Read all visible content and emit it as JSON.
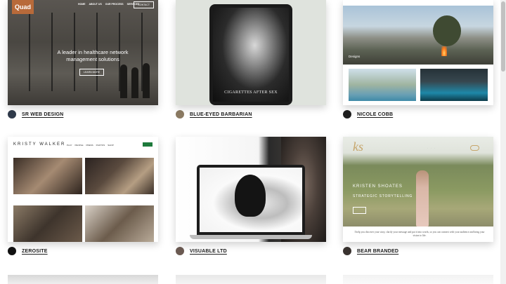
{
  "cards": [
    {
      "caption": "SR WEB DESIGN",
      "avatar_color": "#2f3a4a",
      "preview": {
        "logo": "Quad",
        "nav_links": [
          "HOME",
          "ABOUT US",
          "OUR PROCESS",
          "SERVICES"
        ],
        "contact_label": "CONTACT",
        "headline": "A leader in healthcare network management solutions",
        "button_label": "LEARN MORE"
      }
    },
    {
      "caption": "BLUE-EYED BARBARIAN",
      "avatar_color": "#8b7a62",
      "preview": {
        "screen_text": "CIGARETTES AFTER SEX"
      }
    },
    {
      "caption": "NICOLE COBB",
      "avatar_color": "#1f1f1f",
      "preview": {
        "hero_label": "Designs"
      }
    },
    {
      "caption": "ZEROSITE",
      "avatar_color": "#111111",
      "preview": {
        "logo": "KRISTY WALKER",
        "nav_links": [
          "PLAY",
          "PEOPLE",
          "PRESS",
          "PHOTOS",
          "SHOP"
        ]
      }
    },
    {
      "caption": "VISUABLE LTD",
      "avatar_color": "#6b5a52",
      "preview": {}
    },
    {
      "caption": "BEAR BRANDED",
      "avatar_color": "#3a3330",
      "preview": {
        "monogram": "ks",
        "name": "KRISTEN SHOATES",
        "subtitle": "STRATEGIC STORYTELLING",
        "body_text": "I help you discover your story, clarify your message and put it into words, so you can connect with your audience and bring your vision to life."
      }
    }
  ],
  "colors": {
    "quad_brand": "#b86a3a",
    "kristy_button": "#1e7a3c",
    "kristen_gold": "#c6a56a"
  }
}
